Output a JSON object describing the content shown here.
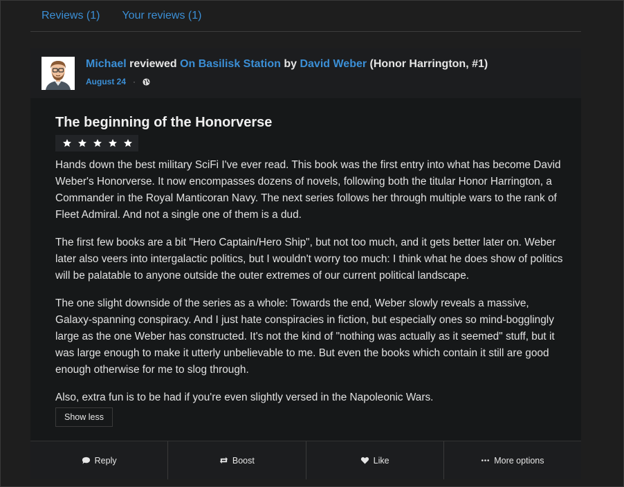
{
  "tabs": [
    {
      "label": "Reviews (1)"
    },
    {
      "label": "Your reviews (1)"
    }
  ],
  "header": {
    "user": "Michael",
    "verb": "reviewed",
    "book_title": "On Basilisk Station",
    "by": "by",
    "author": "David Weber",
    "series": "(Honor Harrington, #1)",
    "date": "August 24",
    "dot": "·",
    "privacy_icon": "globe-icon"
  },
  "review": {
    "title": "The beginning of the Honorverse",
    "rating": 5,
    "rating_max": 5,
    "paragraphs": [
      "Hands down the best military SciFi I've ever read. This book was the first entry into what has become David Weber's Honorverse. It now encompasses dozens of novels, following both the titular Honor Harrington, a Commander in the Royal Manticoran Navy. The next series follows her through multiple wars to the rank of Fleet Admiral. And not a single one of them is a dud.",
      "The first few books are a bit \"Hero Captain/Hero Ship\", but not too much, and it gets better later on. Weber later also veers into intergalactic politics, but I wouldn't worry too much: I think what he does show of politics will be palatable to anyone outside the outer extremes of our current political landscape.",
      "The one slight downside of the series as a whole: Towards the end, Weber slowly reveals a massive, Galaxy-spanning conspiracy. And I just hate conspiracies in fiction, but especially ones so mind-bogglingly large as the one Weber has constructed. It's not the kind of \"nothing was actually as it seemed\" stuff, but it was large enough to make it utterly unbelievable to me. But even the books which contain it still are good enough otherwise for me to slog through.",
      "Also, extra fun is to be had if you're even slightly versed in the Napoleonic Wars."
    ],
    "show_less": "Show less"
  },
  "actions": {
    "reply": "Reply",
    "boost": "Boost",
    "like": "Like",
    "more": "More options"
  },
  "colors": {
    "link": "#3b8fd6",
    "background": "#1e1e1e",
    "card": "#161819",
    "header": "#1c1d1f"
  }
}
